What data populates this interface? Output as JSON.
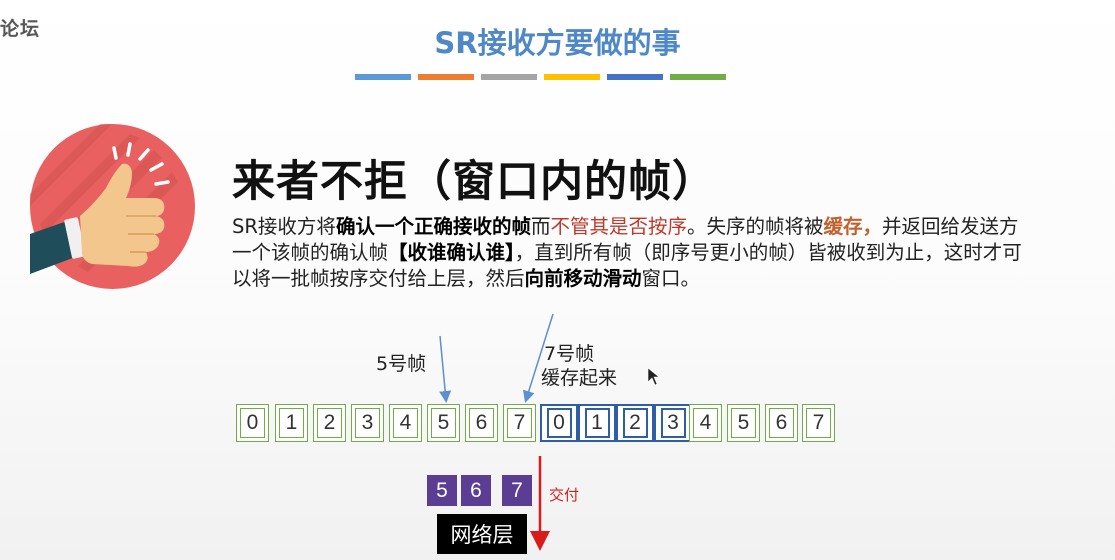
{
  "watermark": {
    "text": "论坛",
    "faint": ""
  },
  "title": "SR接收方要做的事",
  "color_bars": [
    "#5b9bd5",
    "#ed7d31",
    "#a5a5a5",
    "#ffc000",
    "#4472c4",
    "#70ad47"
  ],
  "icon": {
    "name": "thumbs-up-icon",
    "circle_color": "#e8605f"
  },
  "headline": "来者不拒（窗口内的帧）",
  "paragraph": {
    "p1": "SR接收方将",
    "b1": "确认一个正确接收的帧",
    "p2": "而",
    "red1": "不管其是否按序",
    "p3": "。失序的帧将被",
    "orange1": "缓存，",
    "p4": "并返回给发送方一个该帧的确认帧",
    "b2": "【收谁确认谁】",
    "p5": "，直到所有帧（即序号更小的帧）皆被收到为止，这时才可以将一批帧按序交付给上层，然后",
    "b3": "向前移动滑动",
    "p6": "窗口。"
  },
  "labels": {
    "frame5": "5号帧",
    "frame7_line1": "7号帧",
    "frame7_line2": "缓存起来"
  },
  "frames": [
    "0",
    "1",
    "2",
    "3",
    "4",
    "5",
    "6",
    "7",
    "0",
    "1",
    "2",
    "3",
    "4",
    "5",
    "6",
    "7"
  ],
  "delivered_frames": [
    "5",
    "6",
    "7"
  ],
  "deliver_label": "交付",
  "network_layer": "网络层"
}
